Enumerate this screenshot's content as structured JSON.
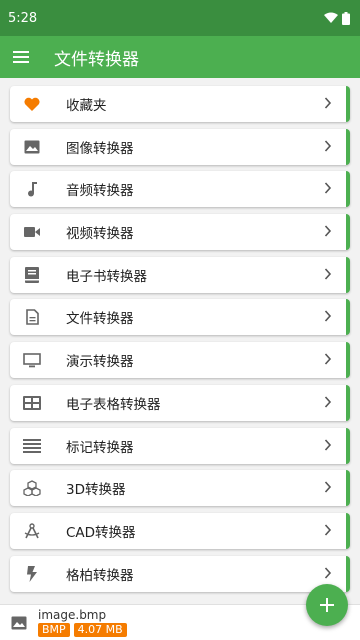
{
  "status_bar": {
    "time": "5:28"
  },
  "app_bar": {
    "title": "文件转换器",
    "menu_icon": "hamburger-menu-icon"
  },
  "colors": {
    "accent": "#4caf50",
    "status_bar": "#3a8e3f",
    "badge": "#f57c00",
    "heart": "#f57c00"
  },
  "items": [
    {
      "label": "收藏夹",
      "icon": "heart-icon"
    },
    {
      "label": "图像转换器",
      "icon": "image-icon"
    },
    {
      "label": "音频转换器",
      "icon": "music-note-icon"
    },
    {
      "label": "视频转换器",
      "icon": "video-camera-icon"
    },
    {
      "label": "电子书转换器",
      "icon": "book-icon"
    },
    {
      "label": "文件转换器",
      "icon": "document-icon"
    },
    {
      "label": "演示转换器",
      "icon": "monitor-icon"
    },
    {
      "label": "电子表格转换器",
      "icon": "table-icon"
    },
    {
      "label": "标记转换器",
      "icon": "lines-icon"
    },
    {
      "label": "3D转换器",
      "icon": "cubes-icon"
    },
    {
      "label": "CAD转换器",
      "icon": "compass-icon"
    },
    {
      "label": "格柏转换器",
      "icon": "flash-icon"
    }
  ],
  "bottom": {
    "file_name": "image.bmp",
    "format": "BMP",
    "size": "4.07 MB",
    "file_icon": "image-icon"
  },
  "fab": {
    "icon": "plus-icon"
  }
}
